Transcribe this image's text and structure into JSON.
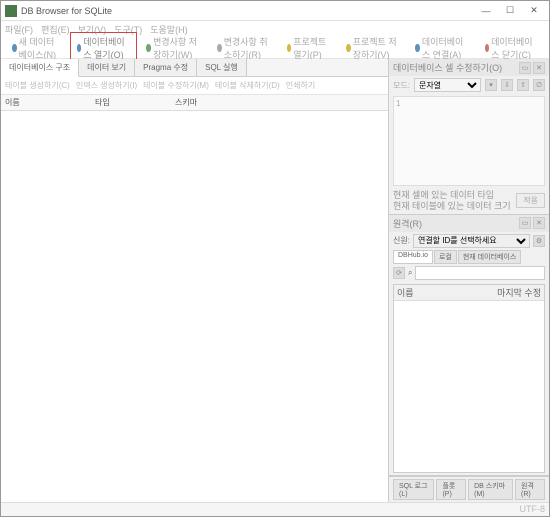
{
  "window": {
    "title": "DB Browser for SQLite"
  },
  "winbtns": {
    "min": "—",
    "max": "☐",
    "close": "✕"
  },
  "menu": [
    "파일(F)",
    "편집(E)",
    "보기(V)",
    "도구(T)",
    "도움말(H)"
  ],
  "toolbar": {
    "new_db": "새 데이터베이스(N)",
    "open_db": "데이터베이스 열기(O)",
    "write_changes": "변경사항 저장하기(W)",
    "revert_changes": "변경사항 취소하기(R)",
    "open_project": "프로젝트 열기(P)",
    "save_project": "프로젝트 저장하기(V)",
    "attach_db": "데이터베이스 연결(A)",
    "close_db": "데이터베이스 닫기(C)"
  },
  "tabs": [
    "데이터베이스 구조",
    "데이터 보기",
    "Pragma 수정",
    "SQL 실행"
  ],
  "subtool": [
    "테이블 생성하기(C)",
    "인덱스 생성하기(I)",
    "테이블 수정하기(M)",
    "테이블 삭제하기(D)",
    "인쇄하기"
  ],
  "colhead": {
    "c1": "이름",
    "c2": "타입",
    "c3": "스키마"
  },
  "cellpanel": {
    "title": "데이터베이스 셀 수정하기(O)",
    "mode_label": "모드:",
    "mode_value": "문자열",
    "content": "1",
    "info1": "현재 셀에 있는 데이터 타입",
    "info2": "현재 테이블에 있는 데이터 크기",
    "apply": "적용"
  },
  "remote": {
    "title": "원격(R)",
    "id_label": "신원:",
    "id_value": "연결할 ID를 선택하세요",
    "tabs": [
      "DBHub.io",
      "로컬",
      "현재 데이터베이스"
    ],
    "search_label": "⌕",
    "search_value": "",
    "list_col1": "이름",
    "list_col2": "마지막 수정"
  },
  "bottom_tabs": [
    "SQL 로그(L)",
    "플롯(P)",
    "DB 스키마(M)",
    "원격(R)"
  ],
  "status": "UTF-8"
}
